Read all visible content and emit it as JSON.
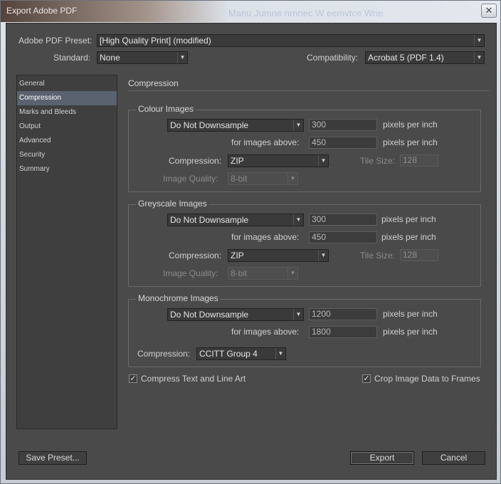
{
  "window": {
    "title": "Export Adobe PDF",
    "close_glyph": "✕"
  },
  "background_hint": "Manu Jumne nrnnec W eemvtce Wrie",
  "header": {
    "preset_label": "Adobe PDF Preset:",
    "preset_value": "[High Quality Print] (modified)",
    "standard_label": "Standard:",
    "standard_value": "None",
    "compat_label": "Compatibility:",
    "compat_value": "Acrobat 5 (PDF 1.4)"
  },
  "sidebar": {
    "items": [
      {
        "label": "General"
      },
      {
        "label": "Compression"
      },
      {
        "label": "Marks and Bleeds"
      },
      {
        "label": "Output"
      },
      {
        "label": "Advanced"
      },
      {
        "label": "Security"
      },
      {
        "label": "Summary"
      }
    ],
    "active_index": 1
  },
  "main": {
    "section_title": "Compression",
    "colour": {
      "title": "Colour Images",
      "downsample": "Do Not Downsample",
      "ppi": "300",
      "ppi_unit": "pixels per inch",
      "above_label": "for images above:",
      "above": "450",
      "above_unit": "pixels per inch",
      "compression_label": "Compression:",
      "compression": "ZIP",
      "tile_label": "Tile Size:",
      "tile": "128",
      "quality_label": "Image Quality:",
      "quality": "8-bit"
    },
    "grey": {
      "title": "Greyscale Images",
      "downsample": "Do Not Downsample",
      "ppi": "300",
      "ppi_unit": "pixels per inch",
      "above_label": "for images above:",
      "above": "450",
      "above_unit": "pixels per inch",
      "compression_label": "Compression:",
      "compression": "ZIP",
      "tile_label": "Tile Size:",
      "tile": "128",
      "quality_label": "Image Quality:",
      "quality": "8-bit"
    },
    "mono": {
      "title": "Monochrome Images",
      "downsample": "Do Not Downsample",
      "ppi": "1200",
      "ppi_unit": "pixels per inch",
      "above_label": "for images above:",
      "above": "1800",
      "above_unit": "pixels per inch",
      "compression_label": "Compression:",
      "compression": "CCITT Group 4"
    },
    "compress_text_label": "Compress Text and Line Art",
    "crop_label": "Crop Image Data to Frames",
    "check_glyph": "✓"
  },
  "footer": {
    "save_preset": "Save Preset...",
    "export": "Export",
    "cancel": "Cancel"
  },
  "arrow_glyph": "▼"
}
